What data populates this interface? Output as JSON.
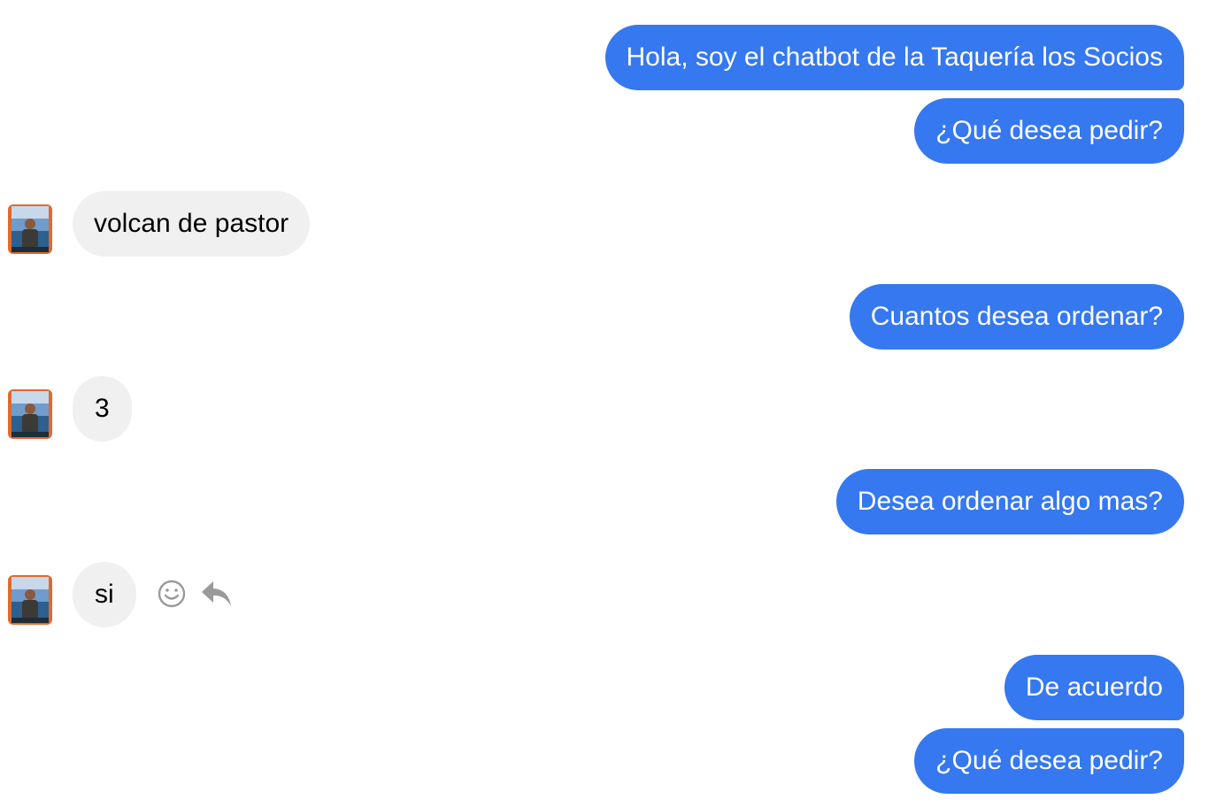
{
  "messages": [
    {
      "from": "bot",
      "text": "Hola, soy el chatbot de la Taquería los Socios"
    },
    {
      "from": "bot",
      "text": "¿Qué desea pedir?"
    },
    {
      "from": "user",
      "text": "volcan de pastor"
    },
    {
      "from": "bot",
      "text": "Cuantos desea ordenar?"
    },
    {
      "from": "user",
      "text": "3"
    },
    {
      "from": "bot",
      "text": "Desea ordenar algo mas?"
    },
    {
      "from": "user",
      "text": "si"
    },
    {
      "from": "bot",
      "text": "De acuerdo"
    },
    {
      "from": "bot",
      "text": "¿Qué desea pedir?"
    }
  ],
  "message_actions": {
    "icons": [
      "smiley-react-icon",
      "reply-arrow-icon"
    ]
  },
  "colors": {
    "outgoing_bubble": "#3578f0",
    "incoming_bubble": "#f0f0f0",
    "icon": "#9a9a9a"
  }
}
